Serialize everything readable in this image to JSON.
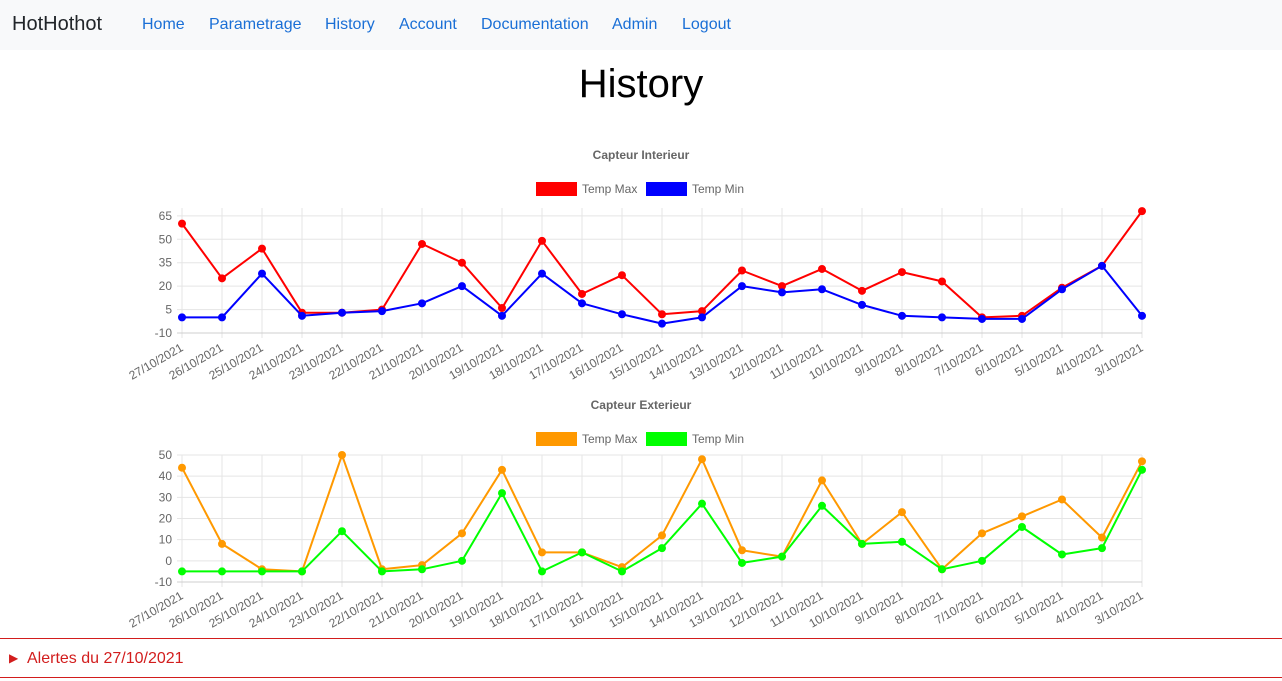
{
  "navbar": {
    "brand": "HotHothot",
    "links": [
      {
        "label": "Home",
        "name": "nav-home"
      },
      {
        "label": "Parametrage",
        "name": "nav-parametrage"
      },
      {
        "label": "History",
        "name": "nav-history"
      },
      {
        "label": "Account",
        "name": "nav-account"
      },
      {
        "label": "Documentation",
        "name": "nav-documentation"
      },
      {
        "label": "Admin",
        "name": "nav-admin"
      },
      {
        "label": "Logout",
        "name": "nav-logout"
      }
    ]
  },
  "page": {
    "title": "History"
  },
  "alert": {
    "label": "Alertes du 27/10/2021",
    "arrow": "▶"
  },
  "chart_data": [
    {
      "type": "line",
      "title": "Capteur Interieur",
      "legend_position": "top-center",
      "grid": true,
      "ylim": [
        -10,
        70
      ],
      "yticks": [
        -10,
        5,
        20,
        35,
        50,
        65
      ],
      "x": [
        "27/10/2021",
        "26/10/2021",
        "25/10/2021",
        "24/10/2021",
        "23/10/2021",
        "22/10/2021",
        "21/10/2021",
        "20/10/2021",
        "19/10/2021",
        "18/10/2021",
        "17/10/2021",
        "16/10/2021",
        "15/10/2021",
        "14/10/2021",
        "13/10/2021",
        "12/10/2021",
        "11/10/2021",
        "10/10/2021",
        "9/10/2021",
        "8/10/2021",
        "7/10/2021",
        "6/10/2021",
        "5/10/2021",
        "4/10/2021",
        "3/10/2021"
      ],
      "series": [
        {
          "name": "Temp Max",
          "color": "#ff0000",
          "values": [
            60,
            25,
            44,
            3,
            3,
            5,
            47,
            35,
            6,
            49,
            15,
            27,
            2,
            4,
            30,
            20,
            31,
            17,
            29,
            23,
            0,
            1,
            19,
            33,
            68
          ]
        },
        {
          "name": "Temp Min",
          "color": "#0000ff",
          "values": [
            0,
            0,
            28,
            1,
            3,
            4,
            9,
            20,
            1,
            28,
            9,
            2,
            -4,
            0,
            20,
            16,
            18,
            8,
            1,
            0,
            -1,
            -1,
            18,
            33,
            1
          ]
        }
      ]
    },
    {
      "type": "line",
      "title": "Capteur Exterieur",
      "legend_position": "top-center",
      "grid": true,
      "ylim": [
        -10,
        50
      ],
      "yticks": [
        -10,
        0,
        10,
        20,
        30,
        40,
        50
      ],
      "x": [
        "27/10/2021",
        "26/10/2021",
        "25/10/2021",
        "24/10/2021",
        "23/10/2021",
        "22/10/2021",
        "21/10/2021",
        "20/10/2021",
        "19/10/2021",
        "18/10/2021",
        "17/10/2021",
        "16/10/2021",
        "15/10/2021",
        "14/10/2021",
        "13/10/2021",
        "12/10/2021",
        "11/10/2021",
        "10/10/2021",
        "9/10/2021",
        "8/10/2021",
        "7/10/2021",
        "6/10/2021",
        "5/10/2021",
        "4/10/2021",
        "3/10/2021"
      ],
      "series": [
        {
          "name": "Temp Max",
          "color": "#ff9900",
          "values": [
            44,
            8,
            -4,
            -5,
            50,
            -4,
            -2,
            13,
            43,
            4,
            4,
            -3,
            12,
            48,
            5,
            2,
            38,
            8,
            23,
            -4,
            13,
            21,
            29,
            11,
            47
          ]
        },
        {
          "name": "Temp Min",
          "color": "#00ff00",
          "values": [
            -5,
            -5,
            -5,
            -5,
            14,
            -5,
            -4,
            0,
            32,
            -5,
            4,
            -5,
            6,
            27,
            -1,
            2,
            26,
            8,
            9,
            -4,
            0,
            16,
            3,
            6,
            43
          ]
        }
      ]
    }
  ]
}
